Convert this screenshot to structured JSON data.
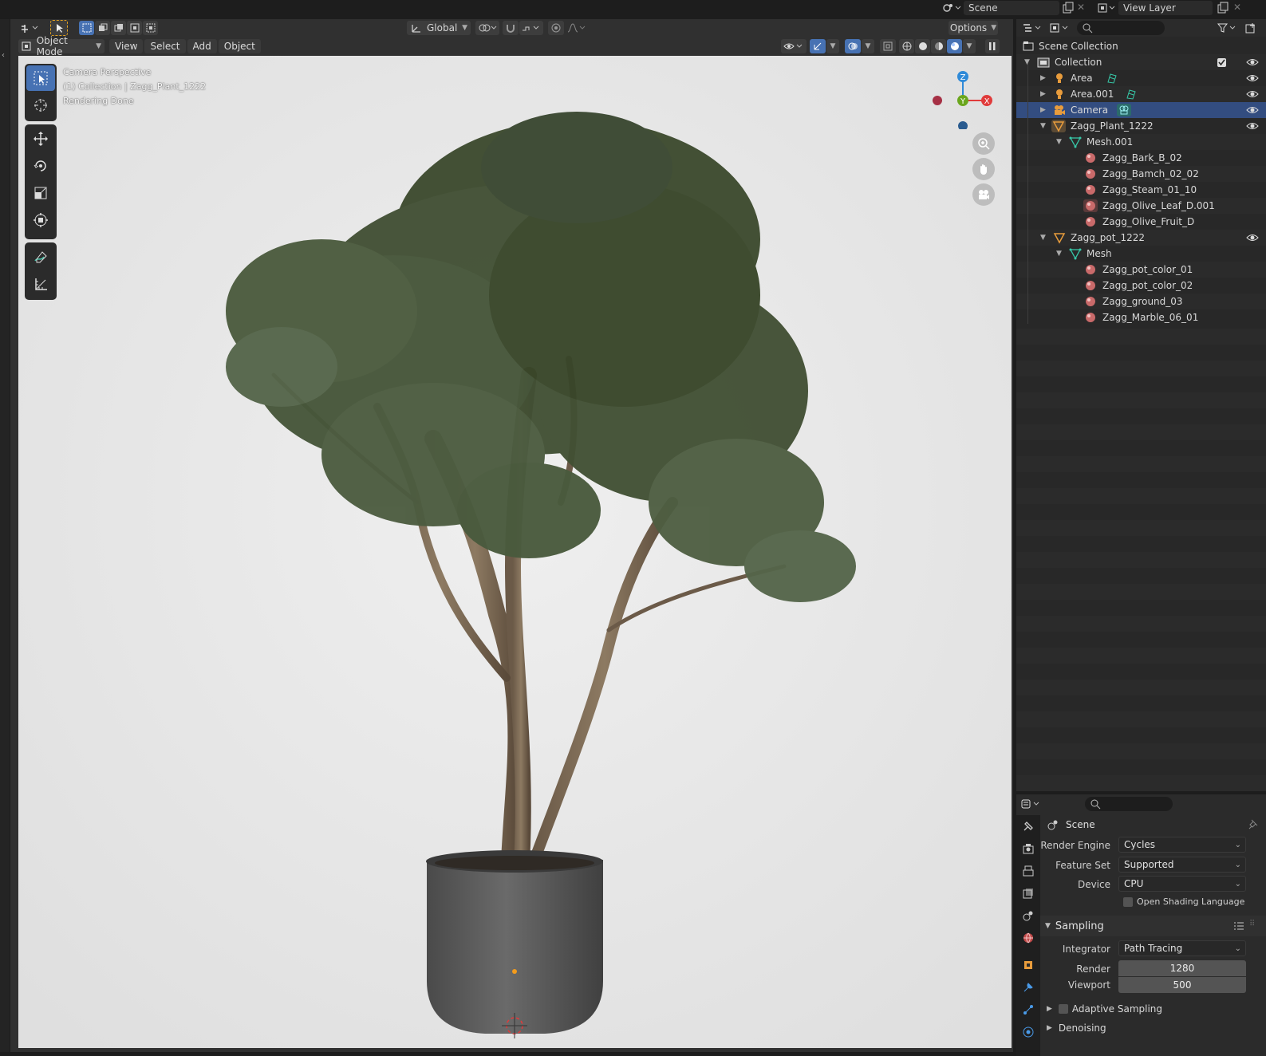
{
  "top_bar": {
    "scene_label": "Scene",
    "view_layer_label": "View Layer"
  },
  "viewport": {
    "transform_orientation": "Global",
    "options_label": "Options",
    "mode": "Object Mode",
    "menus": [
      "View",
      "Select",
      "Add",
      "Object"
    ],
    "overlay_lines": [
      "Camera Perspective",
      "(1) Collection | Zagg_Plant_1222",
      "Rendering Done"
    ],
    "gizmo_axes": {
      "z": "Z",
      "y": "Y",
      "x": "X"
    }
  },
  "outliner": {
    "scene_collection": "Scene Collection",
    "items": [
      {
        "label": "Collection",
        "type": "collection",
        "depth": 0
      },
      {
        "label": "Area",
        "type": "light",
        "depth": 1
      },
      {
        "label": "Area.001",
        "type": "light",
        "depth": 1
      },
      {
        "label": "Camera",
        "type": "camera",
        "depth": 1,
        "selected": true
      },
      {
        "label": "Zagg_Plant_1222",
        "type": "object",
        "depth": 1
      },
      {
        "label": "Mesh.001",
        "type": "mesh",
        "depth": 2
      },
      {
        "label": "Zagg_Bark_B_02",
        "type": "material",
        "depth": 3
      },
      {
        "label": "Zagg_Bamch_02_02",
        "type": "material",
        "depth": 3
      },
      {
        "label": "Zagg_Steam_01_10",
        "type": "material",
        "depth": 3
      },
      {
        "label": "Zagg_Olive_Leaf_D.001",
        "type": "material",
        "depth": 3
      },
      {
        "label": "Zagg_Olive_Fruit_D",
        "type": "material",
        "depth": 3
      },
      {
        "label": "Zagg_pot_1222",
        "type": "object",
        "depth": 1
      },
      {
        "label": "Mesh",
        "type": "mesh",
        "depth": 2
      },
      {
        "label": "Zagg_pot_color_01",
        "type": "material",
        "depth": 3
      },
      {
        "label": "Zagg_pot_color_02",
        "type": "material",
        "depth": 3
      },
      {
        "label": "Zagg_ground_03",
        "type": "material",
        "depth": 3
      },
      {
        "label": "Zagg_Marble_06_01",
        "type": "material",
        "depth": 3
      }
    ]
  },
  "properties": {
    "context": "Scene",
    "render_engine_label": "Render Engine",
    "render_engine": "Cycles",
    "feature_set_label": "Feature Set",
    "feature_set": "Supported",
    "device_label": "Device",
    "device": "CPU",
    "osl_label": "Open Shading Language",
    "sampling_label": "Sampling",
    "integrator_label": "Integrator",
    "integrator": "Path Tracing",
    "render_label": "Render",
    "render_samples": "1280",
    "viewport_label": "Viewport",
    "viewport_samples": "500",
    "adaptive_label": "Adaptive Sampling",
    "denoising_label": "Denoising"
  },
  "colors": {
    "accent": "#4772b3",
    "selected_row": "#334d80",
    "axis_x": "#e03b3b",
    "axis_y": "#6aa61d",
    "axis_z": "#2f8ad8",
    "material": "#c96a6a",
    "mesh": "#37c8a8",
    "object": "#e89c3c"
  }
}
